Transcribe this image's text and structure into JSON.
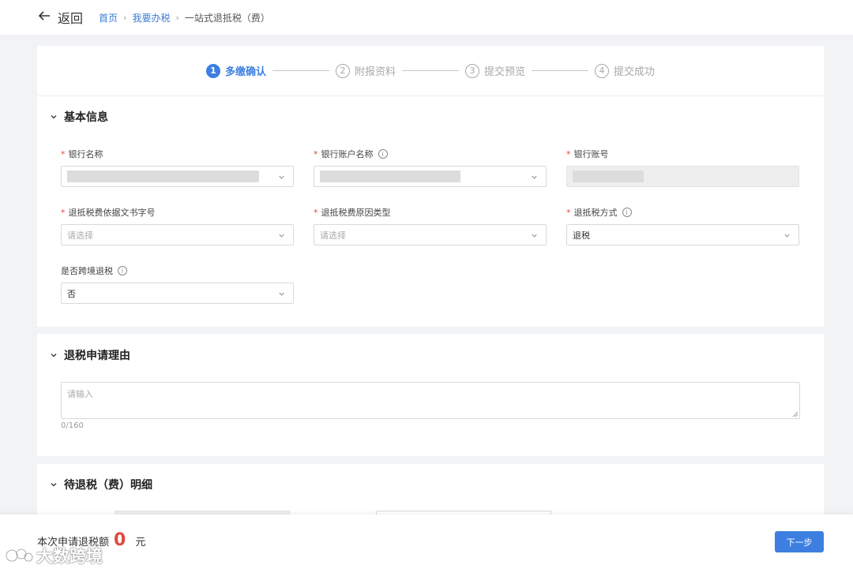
{
  "header": {
    "back_label": "返回",
    "breadcrumb": [
      {
        "label": "首页",
        "link": true
      },
      {
        "label": "我要办税",
        "link": true
      },
      {
        "label": "一站式退抵税（费）",
        "link": false
      }
    ],
    "breadcrumb_separator": "›"
  },
  "steps": [
    {
      "num": "1",
      "label": "多缴确认",
      "active": true
    },
    {
      "num": "2",
      "label": "附报资料",
      "active": false
    },
    {
      "num": "3",
      "label": "提交预览",
      "active": false
    },
    {
      "num": "4",
      "label": "提交成功",
      "active": false
    }
  ],
  "basic_info": {
    "title": "基本信息",
    "fields": {
      "bank_name": {
        "label": "银行名称",
        "required": true
      },
      "account_name": {
        "label": "银行账户名称",
        "required": true,
        "info": true
      },
      "account_no": {
        "label": "银行账号",
        "required": true,
        "disabled": true
      },
      "doc_no": {
        "label": "退抵税费依据文书字号",
        "required": true,
        "placeholder": "请选择"
      },
      "reason_type": {
        "label": "退抵税费原因类型",
        "required": true,
        "placeholder": "请选择"
      },
      "method": {
        "label": "退抵税方式",
        "required": true,
        "info": true,
        "value": "退税"
      },
      "cross_border": {
        "label": "是否跨境退税",
        "required": false,
        "info": true,
        "value": "否"
      }
    }
  },
  "reason": {
    "title": "退税申请理由",
    "placeholder": "请输入",
    "counter": "0/160"
  },
  "details": {
    "title": "待退税（费）明细"
  },
  "footer": {
    "amount_label": "本次申请退税额",
    "amount": "0",
    "unit": "元",
    "next_label": "下一步",
    "watermark": "大数跨境"
  },
  "colors": {
    "primary": "#3d7fe0",
    "required": "#e0493d",
    "amount": "#e0493d",
    "background": "#f2f3f5"
  }
}
